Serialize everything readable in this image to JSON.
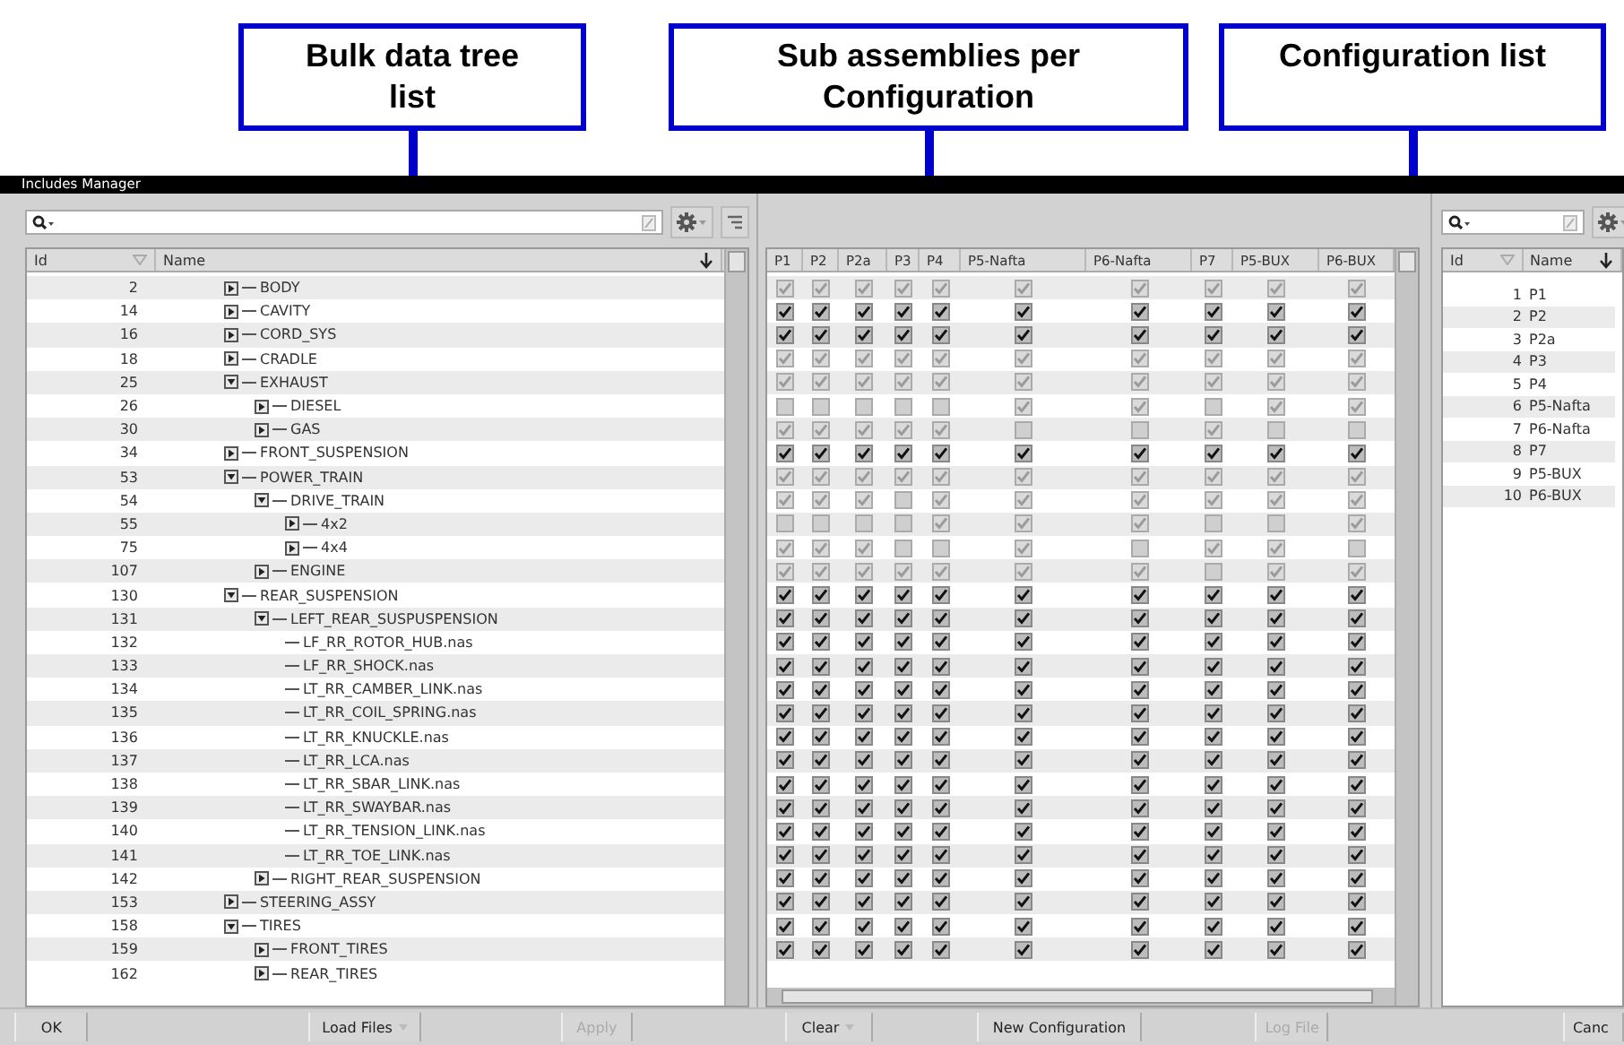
{
  "annotations": [
    {
      "text": "Bulk data tree list"
    },
    {
      "text": "Sub assemblies per Configuration"
    },
    {
      "text": "Configuration list"
    }
  ],
  "window": {
    "title": "Includes Manager"
  },
  "tree_panel": {
    "columns": [
      "Id",
      "Name"
    ],
    "items": [
      {
        "id": "2",
        "name": "BODY",
        "kind": "folder",
        "expanded": false
      },
      {
        "id": "14",
        "name": "CAVITY",
        "kind": "folder",
        "expanded": false
      },
      {
        "id": "16",
        "name": "CORD_SYS",
        "kind": "folder",
        "expanded": false
      },
      {
        "id": "18",
        "name": "CRADLE",
        "kind": "folder",
        "expanded": false
      },
      {
        "id": "25",
        "name": "EXHAUST",
        "kind": "folder",
        "expanded": true,
        "children": [
          {
            "id": "26",
            "name": "DIESEL",
            "kind": "folder",
            "expanded": false
          },
          {
            "id": "30",
            "name": "GAS",
            "kind": "folder",
            "expanded": false
          }
        ]
      },
      {
        "id": "34",
        "name": "FRONT_SUSPENSION",
        "kind": "folder",
        "expanded": false
      },
      {
        "id": "53",
        "name": "POWER_TRAIN",
        "kind": "folder",
        "expanded": true,
        "children": [
          {
            "id": "54",
            "name": "DRIVE_TRAIN",
            "kind": "folder",
            "expanded": true,
            "children": [
              {
                "id": "55",
                "name": "4x2",
                "kind": "folder",
                "expanded": false
              },
              {
                "id": "75",
                "name": "4x4",
                "kind": "folder",
                "expanded": false
              }
            ]
          },
          {
            "id": "107",
            "name": "ENGINE",
            "kind": "folder",
            "expanded": false
          }
        ]
      },
      {
        "id": "130",
        "name": "REAR_SUSPENSION",
        "kind": "folder",
        "expanded": true,
        "children": [
          {
            "id": "131",
            "name": "LEFT_REAR_SUSPUSPENSION",
            "kind": "folder",
            "expanded": true,
            "children": [
              {
                "id": "132",
                "name": "LF_RR_ROTOR_HUB.nas",
                "kind": "file"
              },
              {
                "id": "133",
                "name": "LF_RR_SHOCK.nas",
                "kind": "file"
              },
              {
                "id": "134",
                "name": "LT_RR_CAMBER_LINK.nas",
                "kind": "file"
              },
              {
                "id": "135",
                "name": "LT_RR_COIL_SPRING.nas",
                "kind": "file"
              },
              {
                "id": "136",
                "name": "LT_RR_KNUCKLE.nas",
                "kind": "file"
              },
              {
                "id": "137",
                "name": "LT_RR_LCA.nas",
                "kind": "file"
              },
              {
                "id": "138",
                "name": "LT_RR_SBAR_LINK.nas",
                "kind": "file"
              },
              {
                "id": "139",
                "name": "LT_RR_SWAYBAR.nas",
                "kind": "file"
              },
              {
                "id": "140",
                "name": "LT_RR_TENSION_LINK.nas",
                "kind": "file"
              },
              {
                "id": "141",
                "name": "LT_RR_TOE_LINK.nas",
                "kind": "file"
              }
            ]
          },
          {
            "id": "142",
            "name": "RIGHT_REAR_SUSPENSION",
            "kind": "folder",
            "expanded": false
          }
        ]
      },
      {
        "id": "153",
        "name": "STEERING_ASSY",
        "kind": "folder",
        "expanded": false
      },
      {
        "id": "158",
        "name": "TIRES",
        "kind": "folder",
        "expanded": true,
        "children": [
          {
            "id": "159",
            "name": "FRONT_TIRES",
            "kind": "folder",
            "expanded": false
          },
          {
            "id": "162",
            "name": "REAR_TIRES",
            "kind": "folder",
            "expanded": false
          }
        ]
      }
    ]
  },
  "matrix_panel": {
    "columns": [
      "P1",
      "P2",
      "P2a",
      "P3",
      "P4",
      "P5-Nafta",
      "P6-Nafta",
      "P7",
      "P5-BUX",
      "P6-BUX"
    ],
    "rows": [
      {
        "checked": [
          true,
          true,
          true,
          true,
          true,
          true,
          true,
          true,
          true,
          true
        ],
        "disabled": [
          true,
          true,
          true,
          true,
          true,
          true,
          true,
          true,
          true,
          true
        ]
      },
      {
        "checked": [
          true,
          true,
          true,
          true,
          true,
          true,
          true,
          true,
          true,
          true
        ],
        "disabled": [
          false,
          false,
          false,
          false,
          false,
          false,
          false,
          false,
          false,
          false
        ]
      },
      {
        "checked": [
          true,
          true,
          true,
          true,
          true,
          true,
          true,
          true,
          true,
          true
        ],
        "disabled": [
          false,
          false,
          false,
          false,
          false,
          false,
          false,
          false,
          false,
          false
        ]
      },
      {
        "checked": [
          true,
          true,
          true,
          true,
          true,
          true,
          true,
          true,
          true,
          true
        ],
        "disabled": [
          true,
          true,
          true,
          true,
          true,
          true,
          true,
          true,
          true,
          true
        ]
      },
      {
        "checked": [
          true,
          true,
          true,
          true,
          true,
          true,
          true,
          true,
          true,
          true
        ],
        "disabled": [
          true,
          true,
          true,
          true,
          true,
          true,
          true,
          true,
          true,
          true
        ]
      },
      {
        "checked": [
          false,
          false,
          false,
          false,
          false,
          true,
          true,
          false,
          true,
          true
        ],
        "disabled": [
          true,
          true,
          true,
          true,
          true,
          true,
          true,
          true,
          true,
          true
        ]
      },
      {
        "checked": [
          true,
          true,
          true,
          true,
          true,
          false,
          false,
          true,
          false,
          false
        ],
        "disabled": [
          true,
          true,
          true,
          true,
          true,
          true,
          true,
          true,
          true,
          true
        ]
      },
      {
        "checked": [
          true,
          true,
          true,
          true,
          true,
          true,
          true,
          true,
          true,
          true
        ],
        "disabled": [
          false,
          false,
          false,
          false,
          false,
          false,
          false,
          false,
          false,
          false
        ]
      },
      {
        "checked": [
          true,
          true,
          true,
          true,
          true,
          true,
          true,
          true,
          true,
          true
        ],
        "disabled": [
          true,
          true,
          true,
          true,
          true,
          true,
          true,
          true,
          true,
          true
        ]
      },
      {
        "checked": [
          true,
          true,
          true,
          false,
          true,
          true,
          true,
          true,
          true,
          true
        ],
        "disabled": [
          true,
          true,
          true,
          true,
          true,
          true,
          true,
          true,
          true,
          true
        ]
      },
      {
        "checked": [
          false,
          false,
          false,
          false,
          true,
          true,
          true,
          false,
          false,
          true
        ],
        "disabled": [
          true,
          true,
          true,
          true,
          true,
          true,
          true,
          true,
          true,
          true
        ]
      },
      {
        "checked": [
          true,
          true,
          true,
          false,
          false,
          true,
          false,
          true,
          true,
          false
        ],
        "disabled": [
          true,
          true,
          true,
          true,
          true,
          true,
          true,
          true,
          true,
          true
        ]
      },
      {
        "checked": [
          true,
          true,
          true,
          true,
          true,
          true,
          true,
          false,
          true,
          true
        ],
        "disabled": [
          true,
          true,
          true,
          true,
          true,
          true,
          true,
          true,
          true,
          true
        ]
      },
      {
        "checked": [
          true,
          true,
          true,
          true,
          true,
          true,
          true,
          true,
          true,
          true
        ],
        "disabled": [
          false,
          false,
          false,
          false,
          false,
          false,
          false,
          false,
          false,
          false
        ]
      },
      {
        "checked": [
          true,
          true,
          true,
          true,
          true,
          true,
          true,
          true,
          true,
          true
        ],
        "disabled": [
          false,
          false,
          false,
          false,
          false,
          false,
          false,
          false,
          false,
          false
        ]
      },
      {
        "checked": [
          true,
          true,
          true,
          true,
          true,
          true,
          true,
          true,
          true,
          true
        ],
        "disabled": [
          false,
          false,
          false,
          false,
          false,
          false,
          false,
          false,
          false,
          false
        ]
      },
      {
        "checked": [
          true,
          true,
          true,
          true,
          true,
          true,
          true,
          true,
          true,
          true
        ],
        "disabled": [
          false,
          false,
          false,
          false,
          false,
          false,
          false,
          false,
          false,
          false
        ]
      },
      {
        "checked": [
          true,
          true,
          true,
          true,
          true,
          true,
          true,
          true,
          true,
          true
        ],
        "disabled": [
          false,
          false,
          false,
          false,
          false,
          false,
          false,
          false,
          false,
          false
        ]
      },
      {
        "checked": [
          true,
          true,
          true,
          true,
          true,
          true,
          true,
          true,
          true,
          true
        ],
        "disabled": [
          false,
          false,
          false,
          false,
          false,
          false,
          false,
          false,
          false,
          false
        ]
      },
      {
        "checked": [
          true,
          true,
          true,
          true,
          true,
          true,
          true,
          true,
          true,
          true
        ],
        "disabled": [
          false,
          false,
          false,
          false,
          false,
          false,
          false,
          false,
          false,
          false
        ]
      },
      {
        "checked": [
          true,
          true,
          true,
          true,
          true,
          true,
          true,
          true,
          true,
          true
        ],
        "disabled": [
          false,
          false,
          false,
          false,
          false,
          false,
          false,
          false,
          false,
          false
        ]
      },
      {
        "checked": [
          true,
          true,
          true,
          true,
          true,
          true,
          true,
          true,
          true,
          true
        ],
        "disabled": [
          false,
          false,
          false,
          false,
          false,
          false,
          false,
          false,
          false,
          false
        ]
      },
      {
        "checked": [
          true,
          true,
          true,
          true,
          true,
          true,
          true,
          true,
          true,
          true
        ],
        "disabled": [
          false,
          false,
          false,
          false,
          false,
          false,
          false,
          false,
          false,
          false
        ]
      },
      {
        "checked": [
          true,
          true,
          true,
          true,
          true,
          true,
          true,
          true,
          true,
          true
        ],
        "disabled": [
          false,
          false,
          false,
          false,
          false,
          false,
          false,
          false,
          false,
          false
        ]
      },
      {
        "checked": [
          true,
          true,
          true,
          true,
          true,
          true,
          true,
          true,
          true,
          true
        ],
        "disabled": [
          false,
          false,
          false,
          false,
          false,
          false,
          false,
          false,
          false,
          false
        ]
      },
      {
        "checked": [
          true,
          true,
          true,
          true,
          true,
          true,
          true,
          true,
          true,
          true
        ],
        "disabled": [
          false,
          false,
          false,
          false,
          false,
          false,
          false,
          false,
          false,
          false
        ]
      },
      {
        "checked": [
          true,
          true,
          true,
          true,
          true,
          true,
          true,
          true,
          true,
          true
        ],
        "disabled": [
          false,
          false,
          false,
          false,
          false,
          false,
          false,
          false,
          false,
          false
        ]
      },
      {
        "checked": [
          true,
          true,
          true,
          true,
          true,
          true,
          true,
          true,
          true,
          true
        ],
        "disabled": [
          false,
          false,
          false,
          false,
          false,
          false,
          false,
          false,
          false,
          false
        ]
      },
      {
        "checked": [
          true,
          true,
          true,
          true,
          true,
          true,
          true,
          true,
          true,
          true
        ],
        "disabled": [
          false,
          false,
          false,
          false,
          false,
          false,
          false,
          false,
          false,
          false
        ]
      }
    ]
  },
  "config_panel": {
    "columns": [
      "Id",
      "Name"
    ],
    "rows": [
      {
        "id": "1",
        "name": "P1"
      },
      {
        "id": "2",
        "name": "P2"
      },
      {
        "id": "3",
        "name": "P2a"
      },
      {
        "id": "4",
        "name": "P3"
      },
      {
        "id": "5",
        "name": "P4"
      },
      {
        "id": "6",
        "name": "P5-Nafta"
      },
      {
        "id": "7",
        "name": "P6-Nafta"
      },
      {
        "id": "8",
        "name": "P7"
      },
      {
        "id": "9",
        "name": "P5-BUX"
      },
      {
        "id": "10",
        "name": "P6-BUX"
      }
    ]
  },
  "buttons": [
    {
      "label": "OK",
      "disabled": false,
      "dropdown": false
    },
    {
      "label": "Load Files",
      "disabled": false,
      "dropdown": true
    },
    {
      "label": "Apply",
      "disabled": true,
      "dropdown": false
    },
    {
      "label": "Clear",
      "disabled": false,
      "dropdown": true
    },
    {
      "label": "New Configuration",
      "disabled": false,
      "dropdown": false
    },
    {
      "label": "Log File",
      "disabled": true,
      "dropdown": false
    },
    {
      "label": "Canc",
      "disabled": false,
      "dropdown": false
    }
  ]
}
